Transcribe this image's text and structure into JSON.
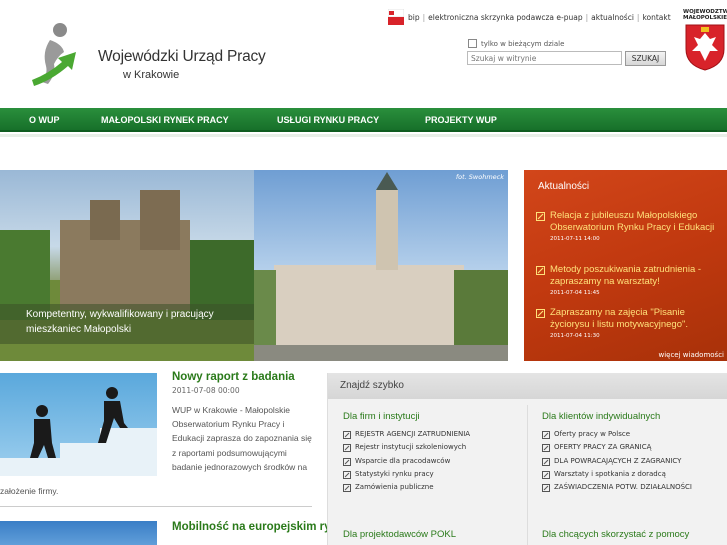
{
  "header": {
    "org_title": "Wojewódzki Urząd Pracy",
    "org_subtitle": "w Krakowie",
    "top_links": [
      "bip",
      "elektroniczna skrzynka podawcza e-puap",
      "aktualności",
      "kontakt"
    ],
    "crest_label": "WOJEWÓDZTWO MAŁOPOLSKIE",
    "search": {
      "checkbox_label": "tylko w bieżącym dziale",
      "placeholder": "Szukaj w witrynie",
      "button_label": "SZUKAJ"
    }
  },
  "nav": {
    "items": [
      "O WUP",
      "MAŁOPOLSKI RYNEK PRACY",
      "USŁUGI RYNKU PRACY",
      "PROJEKTY WUP"
    ]
  },
  "banner": {
    "caption": "Kompetentny, wykwalifikowany i pracujący mieszkaniec Małopolski",
    "photo_credit": "fot. Swohmeck"
  },
  "news": {
    "title": "Aktualności",
    "items": [
      {
        "text": "Relacja z jubileuszu Małopolskiego Obserwatorium Rynku Pracy i Edukacji",
        "date": "2011-07-11 14:00"
      },
      {
        "text": "Metody poszukiwania zatrudnienia - zapraszamy na warsztaty!",
        "date": "2011-07-04 11:45"
      },
      {
        "text": "Zapraszamy na zajęcia \"Pisanie życiorysu i listu motywacyjnego\".",
        "date": "2011-07-04 11:30"
      }
    ],
    "more": "więcej wiadomości"
  },
  "articles": {
    "report": {
      "title": "Nowy raport z badania",
      "date": "2011-07-08 00:00",
      "text": "WUP w Krakowie - Małopolskie Obserwatorium Rynku Pracy i Edukacji zaprasza do zapoznania się z raportami podsumowującymi badanie jednorazowych środków na",
      "text_cont": "założenie firmy."
    },
    "mobility": {
      "title": "Mobilność na europejskim rynku pracy"
    }
  },
  "quick_find": {
    "title": "Znajdź szybko",
    "col1": {
      "heading": "Dla firm i instytucji",
      "links": [
        "REJESTR AGENCJI ZATRUDNIENIA",
        "Rejestr instytucji szkoleniowych",
        "Wsparcie dla pracodawców",
        "Statystyki rynku pracy",
        "Zamówienia publiczne"
      ]
    },
    "col2": {
      "heading": "Dla klientów indywidualnych",
      "links": [
        "Oferty pracy w Polsce",
        "OFERTY PRACY ZA GRANICĄ",
        "DLA POWRACAJĄCYCH Z ZAGRANICY",
        "Warsztaty i spotkania z doradcą",
        "ZAŚWIADCZENIA POTW. DZIAŁALNOŚCI"
      ]
    },
    "col3_heading": "Dla projektodawców POKL",
    "col4_heading": "Dla chcących skorzystać z pomocy"
  },
  "colors": {
    "nav_green": "#1e7f33",
    "news_orange": "#c33a0f",
    "link_green": "#2a7a1a",
    "news_link": "#ffe17a"
  }
}
